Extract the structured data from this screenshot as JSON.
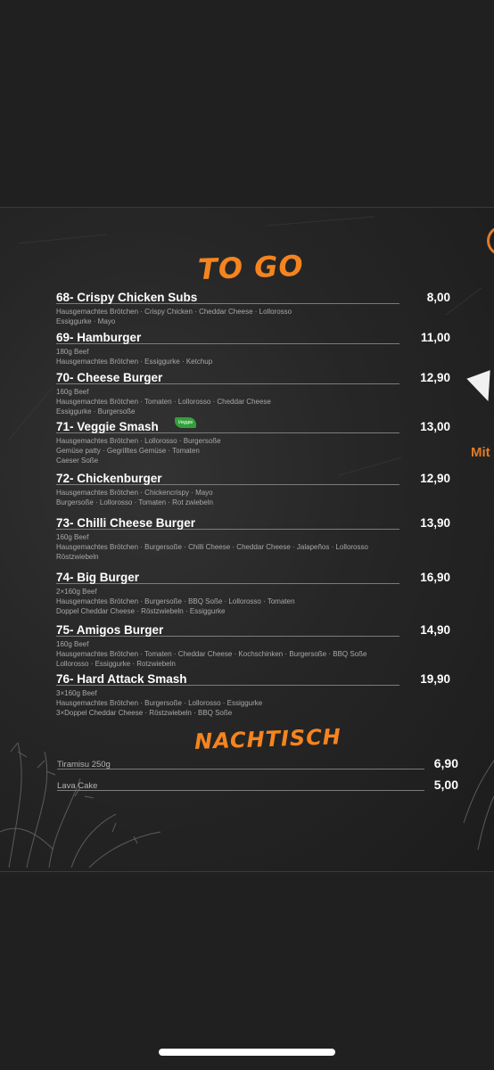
{
  "menu": {
    "togo_title": "TO GO",
    "items": [
      {
        "name": "68- Crispy Chicken Subs",
        "price": "8,00",
        "desc1": "Hausgemachtes Brötchen · Crispy Chicken · Cheddar Cheese · Lollorosso",
        "desc2": "Essiggurke · Mayo",
        "desc3": ""
      },
      {
        "name": "69- Hamburger",
        "price": "11,00",
        "desc1": "180g Beef",
        "desc2": " Hausgemachtes Brötchen · Essiggurke · Ketchup",
        "desc3": ""
      },
      {
        "name": "70- Cheese Burger",
        "price": "12,90",
        "desc1": "160g Beef",
        "desc2": "Hausgemachtes Brötchen · Tomaten · Lollorosso · Cheddar Cheese",
        "desc3": "Essiggurke · Burgersoße"
      },
      {
        "name": "71- Veggie Smash",
        "price": "13,00",
        "badge": "Veggie",
        "desc1": "Hausgemachtes Brötchen · Lollorosso · Burgersoße",
        "desc2": "Gemüse patty · Gegrilltes Gemüse · Tomaten",
        "desc3": "Caeser Soße"
      },
      {
        "name": "72- Chickenburger",
        "price": "12,90",
        "desc1": "Hausgemachtes Brötchen · Chickencrispy · Mayo",
        "desc2": "Burgersoße · Lollorosso · Tomaten · Rot zwiebeln",
        "desc3": ""
      },
      {
        "name": "73- Chilli Cheese Burger",
        "price": "13,90",
        "desc1": "160g Beef",
        "desc2": "Hausgemachtes Brötchen · Burgersoße · Chilli Cheese · Cheddar Cheese · Jalapeños · Lollorosso",
        "desc3": "Röstzwiebeln"
      },
      {
        "name": "74- Big Burger",
        "price": "16,90",
        "desc1": "2×160g Beef",
        "desc2": "Hausgemachtes Brötchen · Burgersoße · BBQ Soße · Lollorosso · Tomaten",
        "desc3": "Doppel Cheddar Cheese · Röstzwiebeln · Essiggurke"
      },
      {
        "name": "75- Amigos Burger",
        "price": "14,90",
        "desc1": "160g Beef",
        "desc2": "Hausgemachtes Brötchen · Tomaten · Cheddar Cheese · Kochschinken · Burgersoße · BBQ Soße",
        "desc3": "Lollorosso · Essiggurke · Rotzwiebeln"
      },
      {
        "name": "76- Hard Attack Smash",
        "price": "19,90",
        "desc1": "3×160g Beef",
        "desc2": "Hausgemachtes Brötchen · Burgersoße · Lollorosso · Essiggurke",
        "desc3": "3×Doppel Cheddar Cheese · Röstzwiebeln · BBQ Soße"
      }
    ],
    "dessert_title": "NACHTISCH",
    "desserts": [
      {
        "name": "Tiramisu 250g",
        "price": "6,90"
      },
      {
        "name": "Lava Cake",
        "price": "5,00"
      }
    ],
    "side_text": "Mit"
  },
  "colors": {
    "accent": "#f5841f",
    "background": "#202020",
    "veggie": "#31a03a"
  }
}
